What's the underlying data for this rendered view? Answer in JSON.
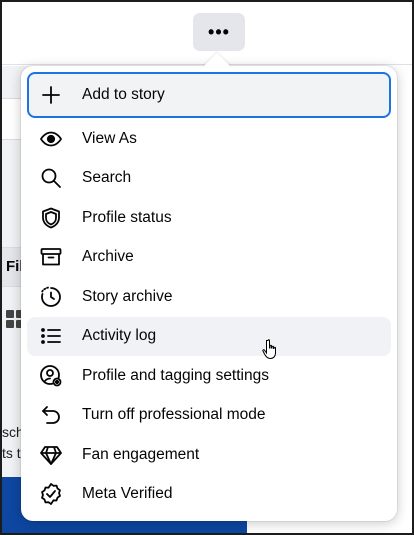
{
  "header": {
    "more_button_label": "•••"
  },
  "background": {
    "tab_fragment": "Fil",
    "text_line_1": "sch",
    "text_line_2": "ts t"
  },
  "menu": {
    "items": [
      {
        "label": "Add to story",
        "icon": "plus-icon"
      },
      {
        "label": "View As",
        "icon": "eye-icon"
      },
      {
        "label": "Search",
        "icon": "search-icon"
      },
      {
        "label": "Profile status",
        "icon": "shield-icon"
      },
      {
        "label": "Archive",
        "icon": "archive-box-icon"
      },
      {
        "label": "Story archive",
        "icon": "clock-history-icon"
      },
      {
        "label": "Activity log",
        "icon": "list-icon"
      },
      {
        "label": "Profile and tagging settings",
        "icon": "user-gear-icon"
      },
      {
        "label": "Turn off professional mode",
        "icon": "undo-arrow-icon"
      },
      {
        "label": "Fan engagement",
        "icon": "diamond-icon"
      },
      {
        "label": "Meta Verified",
        "icon": "verified-badge-icon"
      }
    ]
  },
  "colors": {
    "focus_ring": "#1b74e4",
    "hover_bg": "#f0f2f5",
    "page_bg": "#f0f2f5",
    "banner": "#0d47a1"
  }
}
